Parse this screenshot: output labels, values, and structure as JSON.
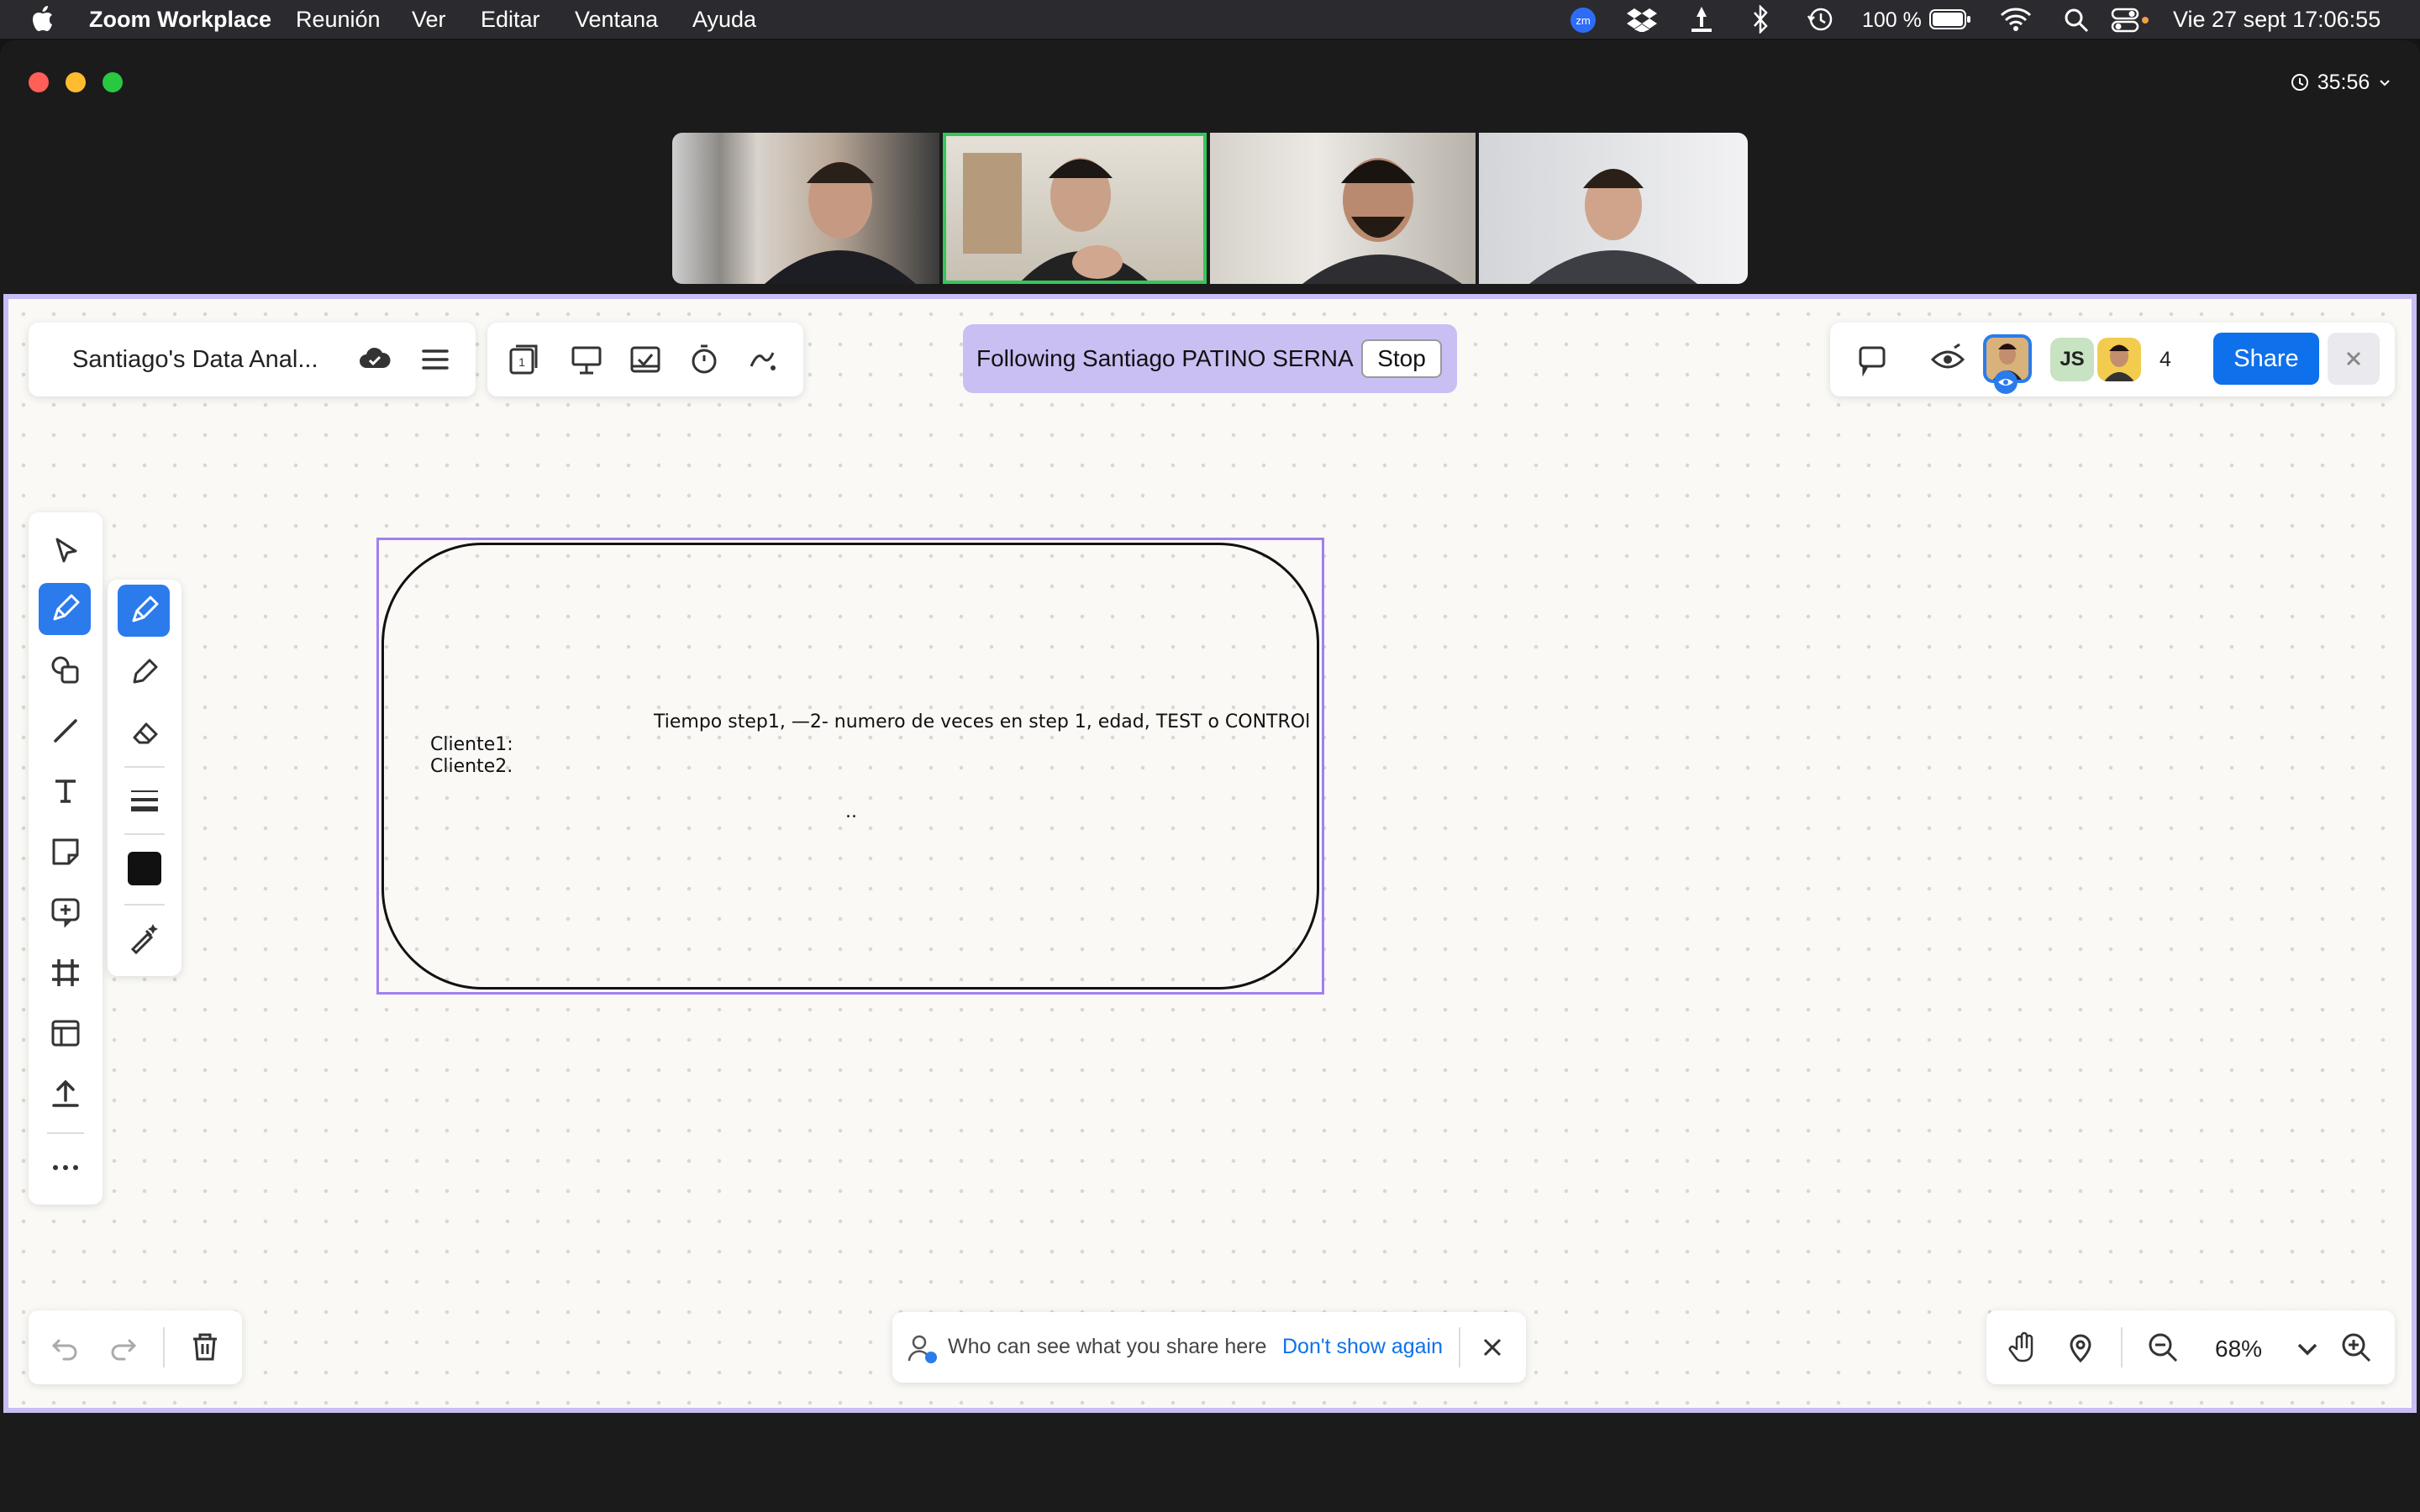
{
  "menubar": {
    "app_name": "Zoom Workplace",
    "menus": [
      "Reunión",
      "Ver",
      "Editar",
      "Ventana",
      "Ayuda"
    ],
    "battery": "100 %",
    "datetime": "Vie 27 sept 17:06:55"
  },
  "meeting": {
    "elapsed": "35:56"
  },
  "whiteboard": {
    "title": "Santiago's Data Anal...",
    "following_text": "Following Santiago PATINO SERNA",
    "stop_label": "Stop",
    "participant_initials": "JS",
    "participant_count": "4",
    "share_label": "Share",
    "canvas": {
      "header_line": "Tiempo step1, —2- numero de veces en step 1, edad, TEST o CONTROl",
      "client1": "Cliente1:",
      "client2": "Cliente2.",
      "dots": ".."
    },
    "banner": {
      "message": "Who can see what you share here",
      "dismiss_link": "Don't show again"
    },
    "zoom_level": "68%"
  },
  "colors": {
    "accent": "#0e71eb",
    "follow_bg": "#c9bff3",
    "selection_border": "#a080f0",
    "active_speaker_border": "#34c759",
    "board_border": "#c9bdf3"
  }
}
